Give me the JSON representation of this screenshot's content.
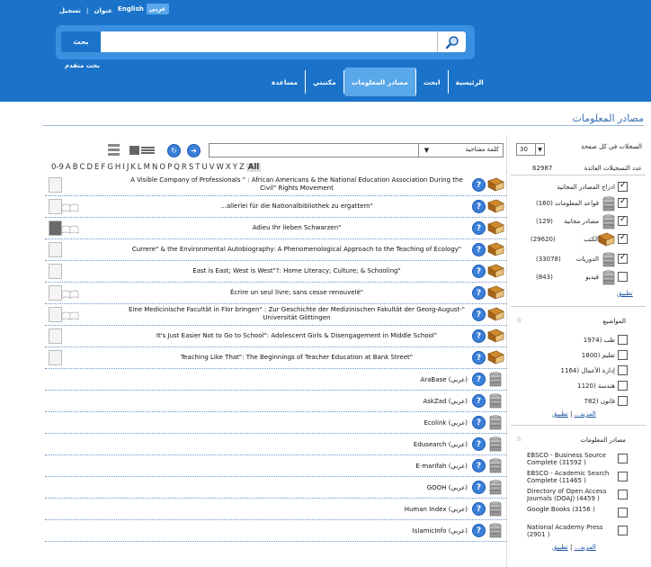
{
  "header": {
    "link_about": "عنوان",
    "link_register": "تسجيل",
    "lang_english": "English",
    "lang_arabic": "عربي",
    "search_button": "بحث",
    "advanced_search": "بحث متقدم",
    "nav": [
      "الرئيسية",
      "ابحث",
      "مصادر المعلومات",
      "مكتبتي",
      "مساعدة"
    ]
  },
  "page_title": "مصادر المعلومات",
  "toolbar": {
    "sort_label": "كلمة مفتاحية",
    "alphabet": [
      "0-9",
      "A",
      "B",
      "C",
      "D",
      "E",
      "F",
      "G",
      "H",
      "I",
      "J",
      "K",
      "L",
      "M",
      "N",
      "O",
      "P",
      "Q",
      "R",
      "S",
      "T",
      "U",
      "V",
      "W",
      "X",
      "Y",
      "Z",
      "All"
    ]
  },
  "results": [
    {
      "title": "A Visible Company of Professionals \" : African Americans & the National Education Association During the Civil\" Rights Movement",
      "type": "book",
      "thumb": "plain"
    },
    {
      "title": "...allerlei für die Nationalbibliothek zu ergattern\"",
      "type": "book",
      "thumb": "cover"
    },
    {
      "title": "Adieu Ihr lieben Schwarzen\"",
      "type": "book",
      "thumb": "photo"
    },
    {
      "title": "Currere\" & the Environmental Autobiography: A Phenomenological Approach to the Teaching of Ecology\"",
      "type": "book",
      "thumb": "plain"
    },
    {
      "title": "East is East; West is West\"?: Home Literacy; Culture; & Schooling\"",
      "type": "book",
      "thumb": "plain"
    },
    {
      "title": "Écrire un seul livre; sans cesse renouvelé\"",
      "type": "book",
      "thumb": "cover"
    },
    {
      "title": "Eine Medicinische Facultät in Flor bringen\" : Zur Geschichte der Medizinischen Fakultät der Georg-August-\" Universität Göttingen",
      "type": "book",
      "thumb": "cover"
    },
    {
      "title": "It's Just Easier Not to Go to School\": Adolescent Girls & Disengagement in Middle School\"",
      "type": "book",
      "thumb": "plain"
    },
    {
      "title": "Teaching Like That\": The Beginnings of Teacher Education at Bank Street\"",
      "type": "book",
      "thumb": "plain"
    },
    {
      "title": "AraBase",
      "lang": "(عربي)",
      "type": "db"
    },
    {
      "title": "AskZad",
      "lang": "(عربي)",
      "type": "db"
    },
    {
      "title": "Ecolink",
      "lang": "(عربي)",
      "type": "db"
    },
    {
      "title": "Edusearch",
      "lang": "(عربي)",
      "type": "db"
    },
    {
      "title": "E-marifah",
      "lang": "(عربي)",
      "type": "db"
    },
    {
      "title": "GOOH",
      "lang": "(عربي)",
      "type": "db"
    },
    {
      "title": "Human Index",
      "lang": "(عربي)",
      "type": "db"
    },
    {
      "title": "IslamicInfo",
      "lang": "(عربي)",
      "type": "db"
    }
  ],
  "sidebar": {
    "per_page_label": "السجلات في كل صفحة",
    "per_page_value": "30",
    "count_label": "عدد التسجيلات العائدة",
    "count_value": "62987",
    "source_types": [
      {
        "label": "ادراج المصادر المجانية",
        "count": "",
        "checked": true
      },
      {
        "label": "قواعد المعلومات",
        "count": "(160)",
        "checked": true
      },
      {
        "label": "مصادر مجانية",
        "count": "(129)",
        "checked": true
      },
      {
        "label": "الكتب",
        "count": "(29620)",
        "checked": true
      },
      {
        "label": "الدوريات",
        "count": "(33078)",
        "checked": true
      },
      {
        "label": "فيديو",
        "count": "(843)",
        "checked": false
      }
    ],
    "apply": "تطبيق",
    "more": "المزيد...",
    "subjects_title": "المواضيع",
    "subjects": [
      "طب (1974",
      "تعليم (1800",
      "إدارة الأعمال (1164",
      "هندسة (1120",
      "قانون (782"
    ],
    "sources_title": "مصادر المعلومات",
    "sources": [
      "EBSCO - Business Source Complete (31592 )",
      "EBSCO - Academic Search Complete (11465 )",
      "Directory of Open Access Journals (DOAJ) (4459 )",
      "Google Books (3156 )",
      "National Academy Press (2901 )"
    ]
  }
}
